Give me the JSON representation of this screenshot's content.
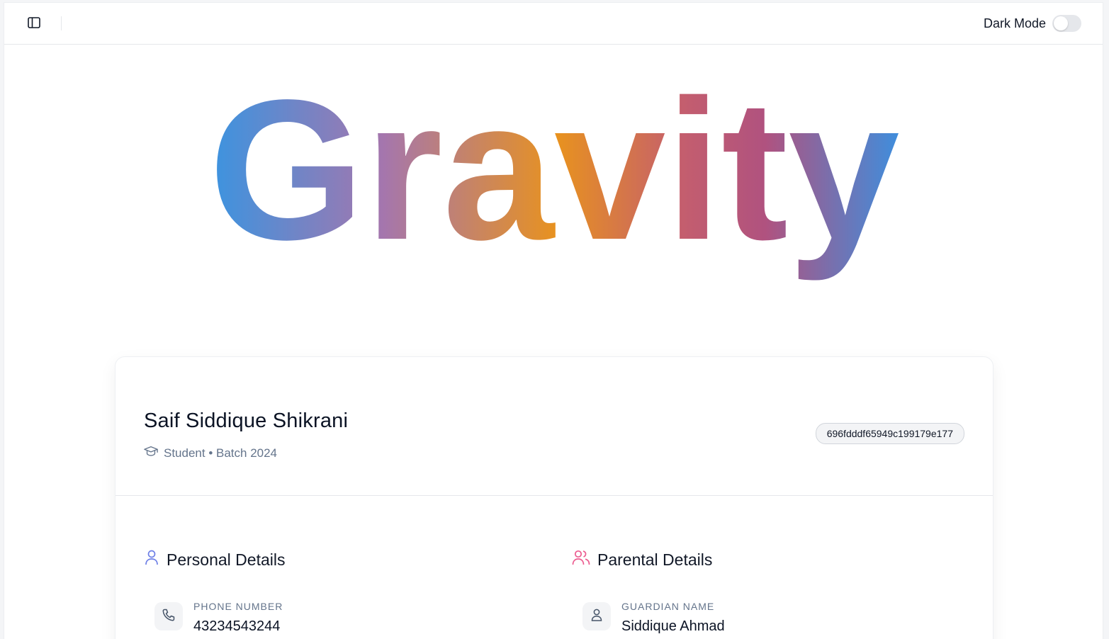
{
  "header": {
    "dark_mode_label": "Dark Mode",
    "dark_mode_enabled": false,
    "sidebar_toggle_icon": "sidebar-panel-icon"
  },
  "logo": {
    "text": "Gravity",
    "gradient": [
      "#3b94e0",
      "#a576ad",
      "#e8921f",
      "#c45e6e",
      "#b0527f",
      "#3b90e0"
    ]
  },
  "profile": {
    "name": "Saif Siddique Shikrani",
    "subtitle": "Student • Batch 2024",
    "subtitle_icon": "graduation-cap-icon",
    "id": "696fdddf65949c199179e177"
  },
  "sections": {
    "personal": {
      "title": "Personal Details",
      "icon": "user-icon",
      "icon_color": "#6d7fe6",
      "fields": [
        {
          "label": "PHONE NUMBER",
          "value": "43234543244",
          "icon": "phone-icon"
        }
      ]
    },
    "parental": {
      "title": "Parental Details",
      "icon": "users-icon",
      "icon_color": "#ec5b8f",
      "fields": [
        {
          "label": "GUARDIAN NAME",
          "value": "Siddique Ahmad",
          "icon": "user-icon"
        }
      ]
    }
  }
}
